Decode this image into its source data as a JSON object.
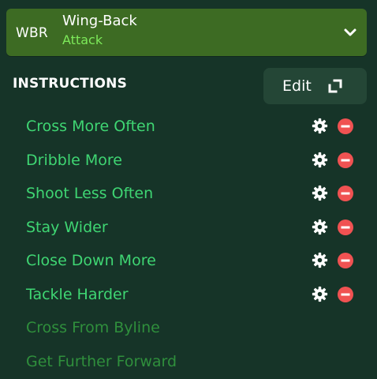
{
  "role": {
    "abbreviation": "WBR",
    "name": "Wing-Back",
    "duty": "Attack",
    "dropdown_icon": "chevron-down-icon"
  },
  "instructions_header": {
    "title": "INSTRUCTIONS",
    "edit_label": "Edit",
    "edit_icon": "expand-icon"
  },
  "instructions": [
    {
      "label": "Cross More Often",
      "active": true
    },
    {
      "label": "Dribble More",
      "active": true
    },
    {
      "label": "Shoot Less Often",
      "active": true
    },
    {
      "label": "Stay Wider",
      "active": true
    },
    {
      "label": "Close Down More",
      "active": true
    },
    {
      "label": "Tackle Harder",
      "active": true
    },
    {
      "label": "Cross From Byline",
      "active": false
    },
    {
      "label": "Get Further Forward",
      "active": false
    }
  ],
  "colors": {
    "background": "#163428",
    "role_bar": "#3d6b23",
    "duty_text": "#7dea5a",
    "active_instruction": "#3fd673",
    "inactive_instruction": "#2f8f3c",
    "remove_icon": "#f05252",
    "edit_button": "#244636"
  }
}
